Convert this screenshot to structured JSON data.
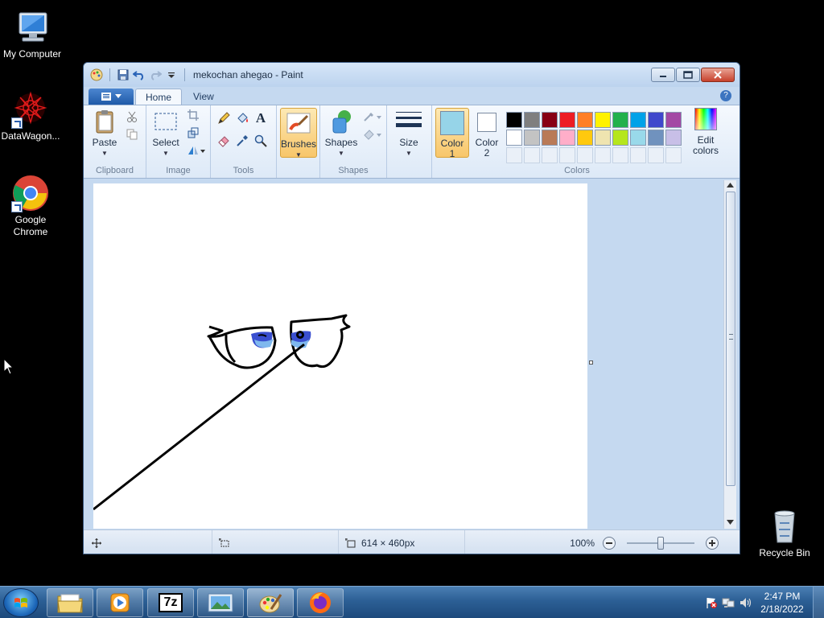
{
  "desktop": {
    "icons": [
      {
        "label": "My Computer"
      },
      {
        "label": "DataWagon..."
      },
      {
        "label": "Google Chrome"
      },
      {
        "label": "Recycle Bin"
      }
    ]
  },
  "window": {
    "title": "mekochan ahegao - Paint",
    "tabs": [
      {
        "label": "Home"
      },
      {
        "label": "View"
      }
    ],
    "help": "?"
  },
  "ribbon": {
    "clipboard": {
      "paste": "Paste",
      "group_label": "Clipboard"
    },
    "image": {
      "select": "Select",
      "group_label": "Image"
    },
    "tools": {
      "group_label": "Tools",
      "text_tool": "A"
    },
    "brushes": {
      "label": "Brushes"
    },
    "shapes": {
      "label": "Shapes",
      "group_label": "Shapes"
    },
    "size": {
      "label": "Size"
    },
    "color1": {
      "label_line1": "Color",
      "label_line2": "1",
      "value": "#96d4e8"
    },
    "color2": {
      "label_line1": "Color",
      "label_line2": "2",
      "value": "#ffffff"
    },
    "colors_group_label": "Colors",
    "edit_colors": {
      "line1": "Edit",
      "line2": "colors"
    },
    "palette_row1": [
      "#000000",
      "#7f7f7f",
      "#880015",
      "#ed1c24",
      "#ff7f27",
      "#fff200",
      "#22b14c",
      "#00a2e8",
      "#3f48cc",
      "#a349a4"
    ],
    "palette_row2": [
      "#ffffff",
      "#c3c3c3",
      "#b97a57",
      "#ffaec9",
      "#ffc90e",
      "#efe4b0",
      "#b5e61d",
      "#99d9ea",
      "#7092be",
      "#c8bfe7"
    ]
  },
  "statusbar": {
    "canvas_size": "614 × 460px",
    "zoom": "100%"
  },
  "taskbar": {
    "time": "2:47 PM",
    "date": "2/18/2022",
    "buttons": [
      {
        "icon": "explorer-icon"
      },
      {
        "icon": "media-player-icon"
      },
      {
        "icon": "7zip-icon",
        "text": "7z"
      },
      {
        "icon": "photo-viewer-icon"
      },
      {
        "icon": "paint-icon"
      },
      {
        "icon": "firefox-icon"
      }
    ]
  }
}
